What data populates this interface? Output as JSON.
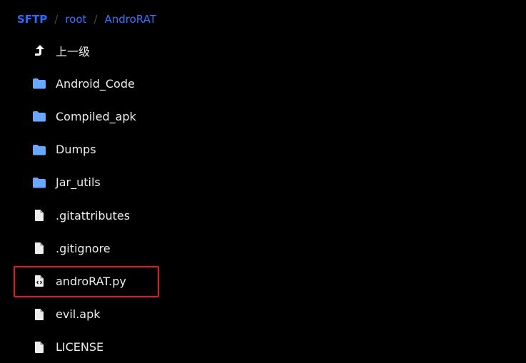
{
  "breadcrumb": {
    "root": "SFTP",
    "items": [
      "root",
      "AndroRAT"
    ],
    "separator": "/"
  },
  "entries": [
    {
      "label": "上一级",
      "icon": "arrow-up-icon",
      "kind": "parent"
    },
    {
      "label": "Android_Code",
      "icon": "folder-icon",
      "kind": "folder"
    },
    {
      "label": "Compiled_apk",
      "icon": "folder-icon",
      "kind": "folder"
    },
    {
      "label": "Dumps",
      "icon": "folder-icon",
      "kind": "folder"
    },
    {
      "label": "Jar_utils",
      "icon": "folder-icon",
      "kind": "folder"
    },
    {
      "label": ".gitattributes",
      "icon": "file-icon",
      "kind": "file"
    },
    {
      "label": ".gitignore",
      "icon": "file-icon",
      "kind": "file"
    },
    {
      "label": "androRAT.py",
      "icon": "code-file-icon",
      "kind": "code",
      "highlighted": true
    },
    {
      "label": "evil.apk",
      "icon": "file-icon",
      "kind": "file"
    },
    {
      "label": "LICENSE",
      "icon": "file-icon",
      "kind": "file"
    }
  ],
  "colors": {
    "background": "#000000",
    "breadcrumb_root": "#2f6bff",
    "breadcrumb_link": "#3a73ff",
    "folder": "#6aa8ff",
    "file": "#eeeeee",
    "highlight": "#e01b1b"
  }
}
